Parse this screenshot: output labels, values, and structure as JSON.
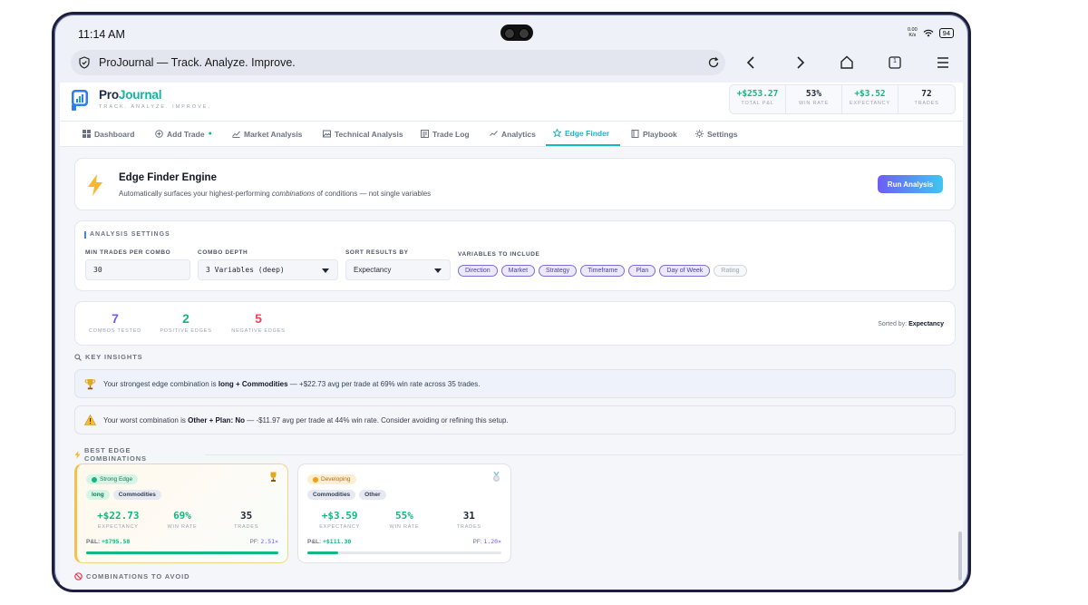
{
  "status": {
    "time": "11:14 AM",
    "net_speed_top": "0.00",
    "net_speed_bottom": "K/s",
    "battery": "94"
  },
  "browser": {
    "url_title": "ProJournal — Track. Analyze. Improve.",
    "tab_count": "1"
  },
  "brand": {
    "name_part1": "Pro",
    "name_part2": "Journal",
    "tagline": "TRACK. ANALYZE. IMPROVE."
  },
  "header_stats": [
    {
      "value": "+$253.27",
      "label": "TOTAL P&L",
      "color": "#10b981"
    },
    {
      "value": "53%",
      "label": "WIN RATE",
      "color": "#1f2937"
    },
    {
      "value": "+$3.52",
      "label": "EXPECTANCY",
      "color": "#10b981"
    },
    {
      "value": "72",
      "label": "TRADES",
      "color": "#1f2937"
    }
  ],
  "tabs": [
    {
      "label": "Dashboard",
      "icon": "grid-icon"
    },
    {
      "label": "Add Trade",
      "icon": "plus-circle-icon",
      "dot": "●"
    },
    {
      "label": "Market Analysis",
      "icon": "trend-icon"
    },
    {
      "label": "Technical Analysis",
      "icon": "image-icon"
    },
    {
      "label": "Trade Log",
      "icon": "log-icon"
    },
    {
      "label": "Analytics",
      "icon": "analytics-icon"
    },
    {
      "label": "Edge Finder",
      "icon": "star-icon",
      "active": true
    },
    {
      "label": "Playbook",
      "icon": "book-icon"
    },
    {
      "label": "Settings",
      "icon": "gear-icon"
    }
  ],
  "engine": {
    "title": "Edge Finder Engine",
    "subtitle_pre": "Automatically surfaces your highest-performing ",
    "subtitle_em": "combinations",
    "subtitle_post": " of conditions — not single variables",
    "run_button": "Run Analysis"
  },
  "settings": {
    "title": "ANALYSIS SETTINGS",
    "min_trades_label": "MIN TRADES PER COMBO",
    "min_trades_value": "30",
    "depth_label": "COMBO DEPTH",
    "depth_value": "3 Variables (deep)",
    "sort_label": "SORT RESULTS BY",
    "sort_value": "Expectancy",
    "variables_label": "VARIABLES TO INCLUDE",
    "variables": [
      {
        "label": "Direction",
        "on": true
      },
      {
        "label": "Market",
        "on": true
      },
      {
        "label": "Strategy",
        "on": true
      },
      {
        "label": "Timeframe",
        "on": true
      },
      {
        "label": "Plan",
        "on": true
      },
      {
        "label": "Day of Week",
        "on": true
      },
      {
        "label": "Rating",
        "on": false
      }
    ]
  },
  "summary": {
    "combos_tested": "7",
    "combos_tested_label": "COMBOS TESTED",
    "positive": "2",
    "positive_label": "POSITIVE EDGES",
    "negative": "5",
    "negative_label": "NEGATIVE EDGES",
    "sorted_prefix": "Sorted by: ",
    "sorted_value": "Expectancy"
  },
  "insights": {
    "title": "KEY INSIGHTS",
    "strongest_pre": "Your strongest edge combination is ",
    "strongest_bold": "long + Commodities",
    "strongest_post": " — +$22.73 avg per trade at 69% win rate across 35 trades.",
    "worst_pre": "Your worst combination is ",
    "worst_bold": "Other + Plan: No",
    "worst_post": " — -$11.97 avg per trade at 44% win rate. Consider avoiding or refining this setup."
  },
  "best": {
    "title": "BEST EDGE COMBINATIONS",
    "cards": [
      {
        "badge": "Strong Edge",
        "tags": [
          "long",
          "Commodities"
        ],
        "expectancy": "+$22.73",
        "win_rate": "69%",
        "trades": "35",
        "pnl": "+$795.58",
        "pf": "2.51×",
        "progress": 1.0
      },
      {
        "badge": "Developing",
        "tags": [
          "Commodities",
          "Other"
        ],
        "expectancy": "+$3.59",
        "win_rate": "55%",
        "trades": "31",
        "pnl": "+$111.30",
        "pf": "1.20×",
        "progress": 0.16
      }
    ],
    "metric_labels": {
      "expectancy": "EXPECTANCY",
      "win_rate": "WIN RATE",
      "trades": "TRADES",
      "pnl": "P&L: ",
      "pf": "PF: "
    }
  },
  "avoid": {
    "title": "COMBINATIONS TO AVOID"
  }
}
